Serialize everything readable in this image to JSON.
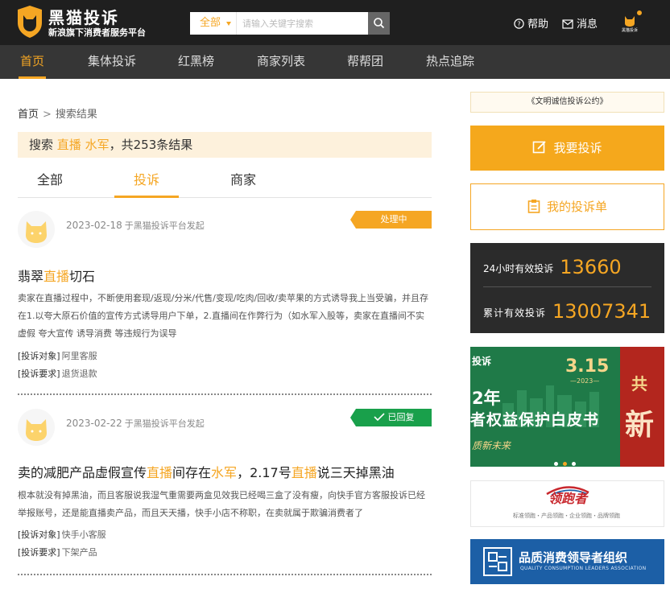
{
  "header": {
    "logo_title": "黑猫投诉",
    "logo_subtitle": "新浪旗下消费者服务平台",
    "search_category": "全部",
    "search_placeholder": "请输入关键字搜索",
    "help_label": "帮助",
    "message_label": "消息",
    "avatar_label": "黑猫投诉"
  },
  "nav": {
    "items": [
      "首页",
      "集体投诉",
      "红黑榜",
      "商家列表",
      "帮帮团",
      "热点追踪"
    ],
    "active": "首页"
  },
  "breadcrumb": {
    "home": "首页",
    "separator": ">",
    "current": "搜索结果"
  },
  "search_result": {
    "prefix": "搜索",
    "keyword1": "直播",
    "keyword2": "水军",
    "suffix": "，共253条结果"
  },
  "tabs": {
    "all": "全部",
    "complaint": "投诉",
    "merchant": "商家",
    "active": "投诉"
  },
  "complaints": [
    {
      "date": "2023-02-18",
      "source": "于黑猫投诉平台发起",
      "status": "处理中",
      "title_before": "翡翠",
      "title_hl1": "直播",
      "title_after": "切石",
      "body": "卖家在直播过程中，不断使用套现/返现/分米/代售/变现/吃肉/回收/卖苹果的方式诱导我上当受骗，并且存在1.以夸大原石价值的宣传方式诱导用户下单，2.直播间在作弊行为（如水军入股等，卖家在直播间不实 虚假 夸大宣传 诱导消费 等违规行为误导",
      "target_label": "[投诉对象]",
      "target": "阿里客服",
      "request_label": "[投诉要求]",
      "request": "退货退款"
    },
    {
      "date": "2023-02-22",
      "source": "于黑猫投诉平台发起",
      "status": "已回复",
      "title_before": "卖的减肥产品虚假宣传",
      "title_hl1": "直播",
      "title_mid1": "间存在",
      "title_hl2": "水军",
      "title_mid2": "，2.17号",
      "title_hl3": "直播",
      "title_after": "说三天掉黑油",
      "body": "根本就没有掉黑油，而且客服说我湿气重需要两盒见效我已经喝三盒了没有瘦，向快手官方客服投诉已经举报账号，还是能直播卖产品，而且天天播，快手小店不称职，在卖就属于欺骗消费者了",
      "target_label": "[投诉对象]",
      "target": "快手小客服",
      "request_label": "[投诉要求]",
      "request": "下架产品"
    }
  ],
  "sidebar": {
    "convention": "《文明诚信投诉公约》",
    "complain_button": "我要投诉",
    "my_complaints_button": "我的投诉单",
    "stat1_label": "24小时有效投诉",
    "stat1_value": "13660",
    "stat2_label": "累计有效投诉",
    "stat2_value": "13007341",
    "banner": {
      "brand": "投诉",
      "year": "2年",
      "event_number": "3.15",
      "event_sub": "—2023—",
      "main": "者权益保护白皮书",
      "slogan": "质新未来",
      "side_top": "共",
      "side_big": "新"
    },
    "ad1_name": "领跑者",
    "ad1_sub": "标准领跑・产品领跑・企业领跑・品牌领跑",
    "ad2_name": "品质消费领导者组织",
    "ad2_sub": "QUALITY CONSUMPTION LEADERS ASSOCIATION"
  },
  "colors": {
    "accent": "#f5a623",
    "header_bg": "#1f1f1f",
    "nav_bg": "#363636",
    "replied": "#19a04b"
  }
}
